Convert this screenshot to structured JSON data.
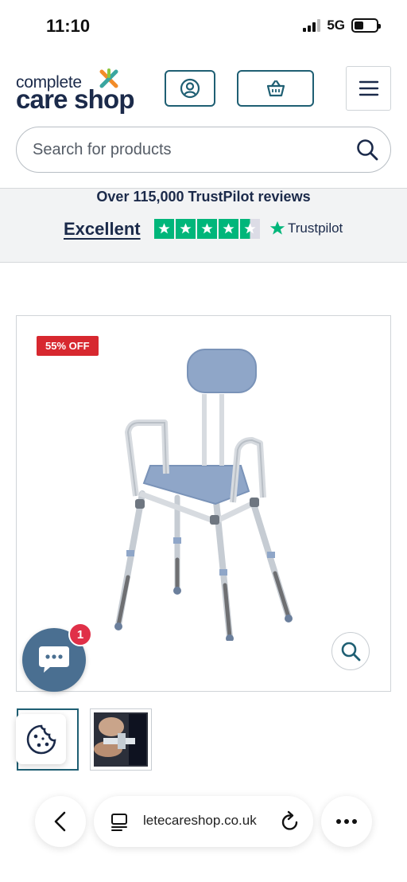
{
  "status_bar": {
    "time": "11:10",
    "network": "5G",
    "battery_level": 0.42
  },
  "header": {
    "logo_top": "complete",
    "logo_bottom": "care shop",
    "account_icon": "user-circle-icon",
    "basket_icon": "basket-icon",
    "menu_icon": "hamburger-icon"
  },
  "search": {
    "placeholder": "Search for products",
    "icon": "search-icon"
  },
  "trust": {
    "reviews_text": "Over 115,000 TrustPilot reviews",
    "rating_label": "Excellent",
    "stars": 4.5,
    "brand": "Trustpilot",
    "brand_color": "#00b67a"
  },
  "product": {
    "badge": "55% OFF",
    "badge_color": "#d7282f",
    "zoom_icon": "magnifier-icon"
  },
  "chat": {
    "badge_count": "1",
    "icon": "chat-bubble-icon"
  },
  "cookie": {
    "icon": "cookie-icon"
  },
  "browser": {
    "url": "letecareshop.co.uk",
    "back_icon": "chevron-left-icon",
    "tabs_icon": "tabs-icon",
    "reload_icon": "reload-icon",
    "more_icon": "ellipsis-icon"
  },
  "colors": {
    "brand_teal": "#1f5f73",
    "navy": "#1b2a4a",
    "chair_blue": "#8fa6c8"
  }
}
